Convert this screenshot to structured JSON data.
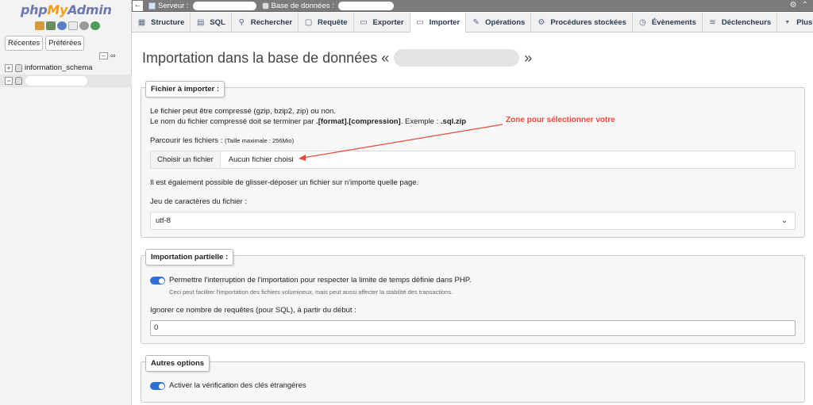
{
  "sidebar": {
    "logo_php": "php",
    "logo_my": "My",
    "logo_admin": "Admin",
    "tab_recent": "Récentes",
    "tab_favorites": "Préférées",
    "collapse_glyph": "−",
    "link_glyph": "∞",
    "tree": [
      {
        "expander": "+",
        "label": "information_schema"
      },
      {
        "expander": "−",
        "label": ""
      }
    ]
  },
  "topbar": {
    "back_glyph": "←",
    "server_label": "Serveur :",
    "database_label": "Base de données :",
    "right_icons": [
      "⚙",
      "⌃"
    ]
  },
  "tabs": [
    {
      "label": "Structure",
      "icon": "▦",
      "icon_name": "structure-icon"
    },
    {
      "label": "SQL",
      "icon": "▤",
      "icon_name": "sql-icon"
    },
    {
      "label": "Rechercher",
      "icon": "⚲",
      "icon_name": "search-icon"
    },
    {
      "label": "Requête",
      "icon": "▢",
      "icon_name": "query-icon"
    },
    {
      "label": "Exporter",
      "icon": "▭",
      "icon_name": "export-icon"
    },
    {
      "label": "Importer",
      "icon": "▭",
      "icon_name": "import-icon",
      "active": true
    },
    {
      "label": "Opérations",
      "icon": "✎",
      "icon_name": "wrench-icon"
    },
    {
      "label": "Procédures stockées",
      "icon": "⚙",
      "icon_name": "routines-icon"
    },
    {
      "label": "Évènements",
      "icon": "◷",
      "icon_name": "clock-icon"
    },
    {
      "label": "Déclencheurs",
      "icon": "≋",
      "icon_name": "triggers-icon"
    },
    {
      "label": "Plus",
      "icon": "▼",
      "icon_name": "caret-down-icon"
    }
  ],
  "main": {
    "title_prefix": "Importation dans la base de données «",
    "title_suffix": "»",
    "file_section": {
      "legend": "Fichier à importer :",
      "line1": "Le fichier peut être compressé (gzip, bzip2, zip) ou non.",
      "line2_pre": "Le nom du fichier compressé doit se terminer par ",
      "line2_format": ".[format].[compression]",
      "line2_mid": ". Exemple : ",
      "line2_example": ".sql.zip",
      "browse_label": "Parcourir les fichiers :",
      "max_size": "(Taille maximale : 256Mio)",
      "choose_button": "Choisir un fichier",
      "no_file": "Aucun fichier choisi",
      "drag_drop": "Il est également possible de glisser-déposer un fichier sur n'importe quelle page.",
      "charset_label": "Jeu de caractères du fichier :",
      "charset_value": "utf-8",
      "chevron": "⌄"
    },
    "partial_section": {
      "legend": "Importation partielle :",
      "interrupt_label": "Permettre l'interruption de l'importation pour respecter la limite de temps définie dans PHP.",
      "interrupt_note": "Ceci peut faciliter l'importation des fichiers volumineux, mais peut aussi affecter la stabilité des transactions.",
      "interrupt_enabled": true,
      "skip_label": "Ignorer ce nombre de requêtes (pour SQL), à partir du début :",
      "skip_value": "0"
    },
    "other_section": {
      "legend": "Autres options",
      "fk_label": "Activer la vérification des clés étrangères",
      "fk_enabled": true
    },
    "annotation": "Zone pour sélectionner votre"
  },
  "colors": {
    "annotation": "#e8493a",
    "toggle_on": "#2f6fd6",
    "logo_blue": "#6c78af",
    "logo_orange": "#f89c0e"
  }
}
